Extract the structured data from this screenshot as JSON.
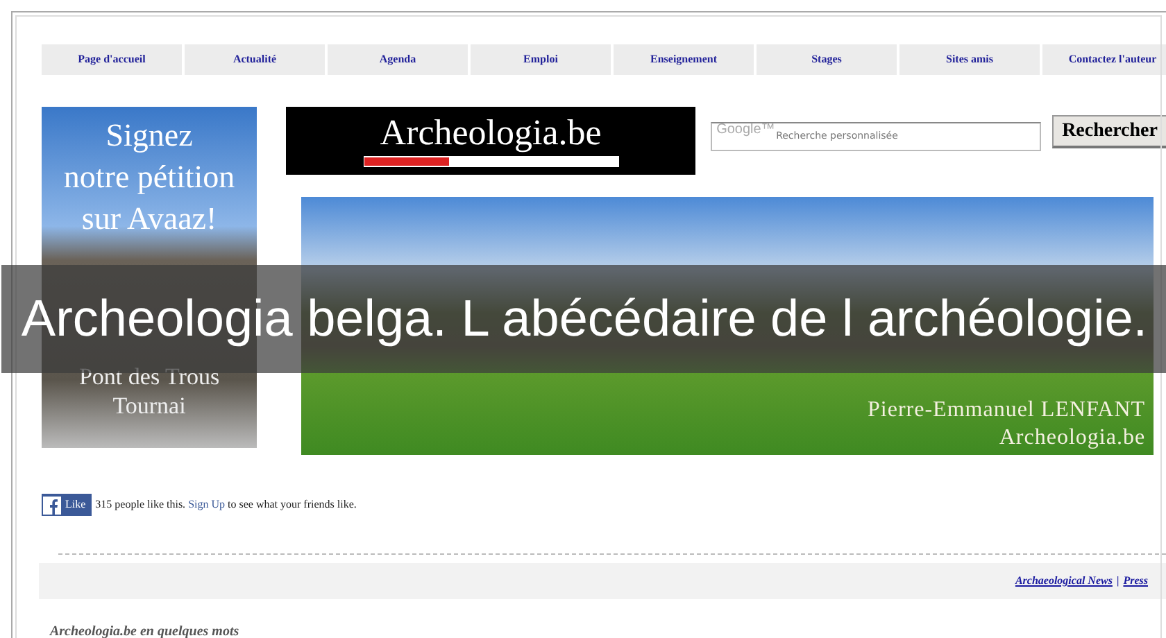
{
  "nav": [
    "Page d'accueil",
    "Actualité",
    "Agenda",
    "Emploi",
    "Enseignement",
    "Stages",
    "Sites amis",
    "Contactez l'auteur"
  ],
  "petition_banner": {
    "lines": [
      "Signez",
      "notre pétition",
      "sur Avaaz!"
    ],
    "caption": [
      "Pont des Trous",
      "Tournai"
    ]
  },
  "logo": {
    "text": "Archeologia.be"
  },
  "search": {
    "brand": "Google™",
    "placeholder": "Recherche personnalisée",
    "button": "Rechercher"
  },
  "header_banner": {
    "lines": [
      "Pierre-Emmanuel LENFANT",
      "Archeologia.be"
    ]
  },
  "facebook": {
    "button": "Like",
    "before": "315 people like this.",
    "link": "Sign Up",
    "after": "to see what your friends like."
  },
  "footer_links": {
    "items": [
      "Archaeological News",
      "Press"
    ],
    "separator": "|"
  },
  "section_title": "Archeologia.be en quelques mots",
  "overlay_title": "Archeologia belga. L abécédaire de l archéologie."
}
